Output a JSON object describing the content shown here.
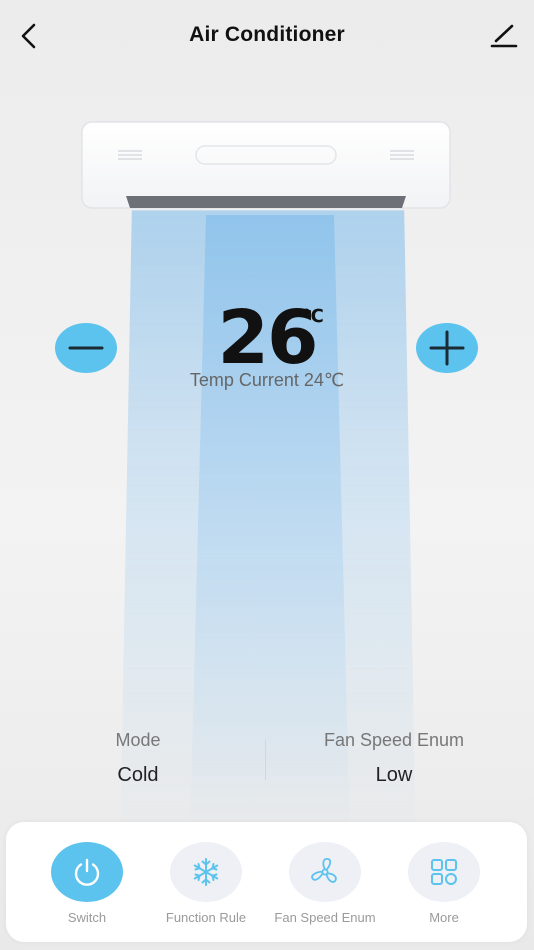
{
  "header": {
    "title": "Air Conditioner",
    "back_icon": "chevron-left-icon",
    "edit_icon": "pencil-icon"
  },
  "temperature": {
    "value": "26",
    "unit": "℃",
    "current": "Temp Current 24℃"
  },
  "controls": {
    "decrease_icon": "minus-icon",
    "increase_icon": "plus-icon",
    "accent_color": "#5cc3ee"
  },
  "info": {
    "mode_label": "Mode",
    "mode_value": "Cold",
    "fan_label": "Fan Speed Enum",
    "fan_value": "Low"
  },
  "toolbar": {
    "items": [
      {
        "label": "Switch",
        "icon": "power-icon",
        "active": true
      },
      {
        "label": "Function Rule",
        "icon": "snowflake-icon",
        "active": false
      },
      {
        "label": "Fan Speed Enum",
        "icon": "fan-icon",
        "active": false
      },
      {
        "label": "More",
        "icon": "grid-icon",
        "active": false
      }
    ]
  }
}
